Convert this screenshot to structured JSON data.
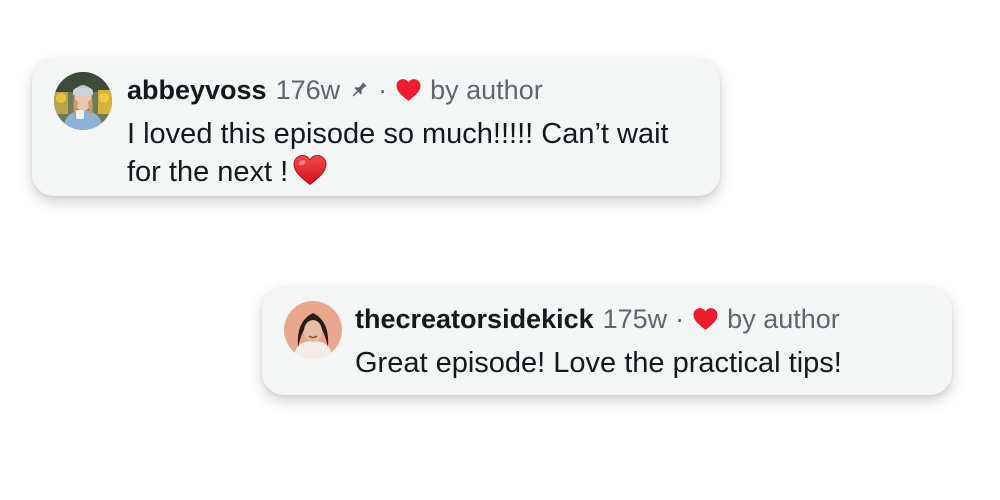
{
  "comments": [
    {
      "username": "abbeyvoss",
      "timestamp": "176w",
      "pinned": true,
      "separator": "·",
      "liked_by_author": true,
      "liked_label": "by author",
      "text": "I loved this episode so much!!!!! Can’t wait for the next !",
      "emoji": "heart-emoji"
    },
    {
      "username": "thecreatorsidekick",
      "timestamp": "175w",
      "pinned": false,
      "separator": "·",
      "liked_by_author": true,
      "liked_label": "by author",
      "text": "Great episode! Love the practical tips!"
    }
  ],
  "colors": {
    "heart": "#ed1c2e",
    "muted_text": "#5e6670",
    "card_background": "#f4f5f5"
  }
}
